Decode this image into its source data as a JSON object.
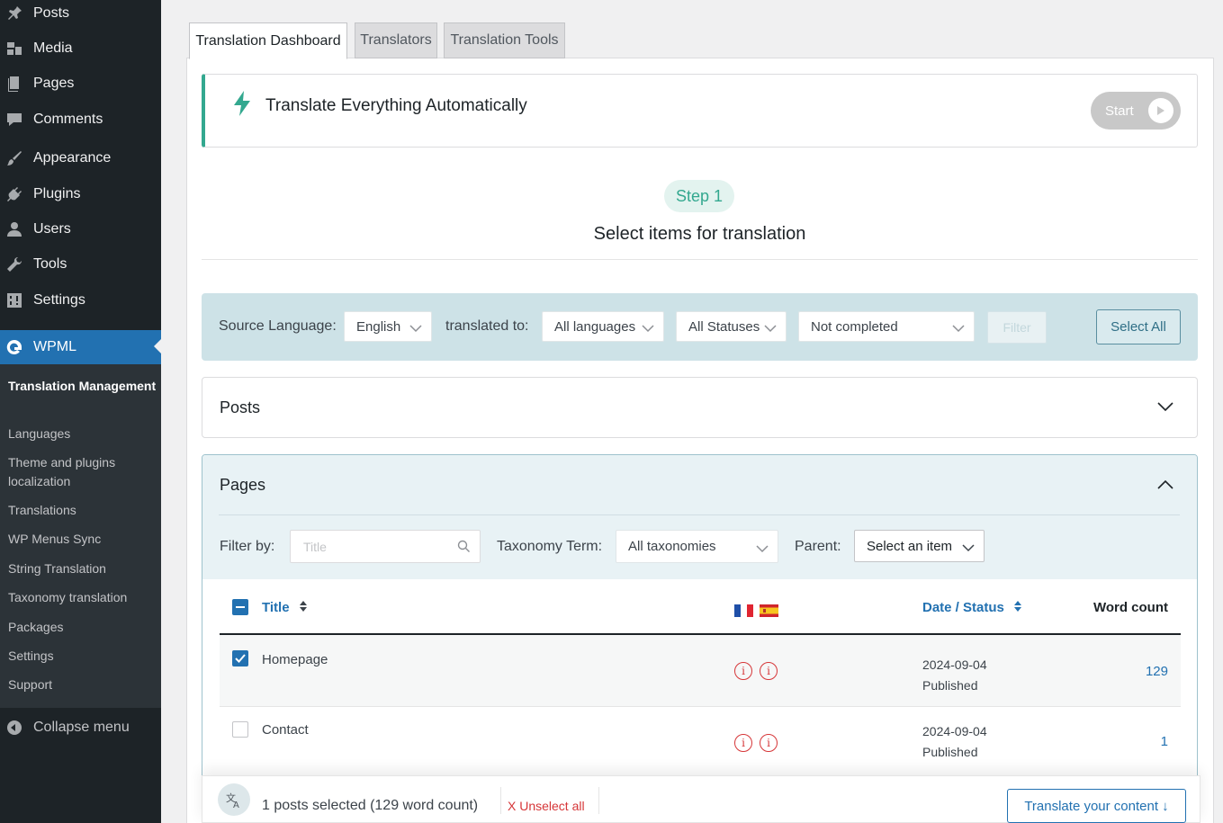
{
  "sidebar": {
    "menu": [
      {
        "label": "Posts",
        "icon": "pin-icon"
      },
      {
        "label": "Media",
        "icon": "media-icon"
      },
      {
        "label": "Pages",
        "icon": "pages-icon"
      },
      {
        "label": "Comments",
        "icon": "comment-icon"
      },
      {
        "label": "Appearance",
        "icon": "brush-icon"
      },
      {
        "label": "Plugins",
        "icon": "plug-icon"
      },
      {
        "label": "Users",
        "icon": "user-icon"
      },
      {
        "label": "Tools",
        "icon": "wrench-icon"
      },
      {
        "label": "Settings",
        "icon": "sliders-icon"
      }
    ],
    "wpml": "WPML",
    "submenu": [
      "Translation Management",
      "Languages",
      "Theme and plugins localization",
      "Translations",
      "WP Menus Sync",
      "String Translation",
      "Taxonomy translation",
      "Packages",
      "Settings",
      "Support"
    ],
    "collapse": "Collapse menu"
  },
  "tabs": [
    "Translation Dashboard",
    "Translators",
    "Translation Tools"
  ],
  "auto_translate": {
    "title": "Translate Everything Automatically",
    "start": "Start"
  },
  "step": {
    "pill": "Step 1",
    "title": "Select items for translation"
  },
  "filters": {
    "source_label": "Source Language:",
    "source_value": "English",
    "translated_label": "translated to:",
    "languages_value": "All languages",
    "statuses_value": "All Statuses",
    "completion_value": "Not completed",
    "filter_button": "Filter",
    "select_all": "Select All"
  },
  "posts_section": {
    "title": "Posts"
  },
  "pages_section": {
    "title": "Pages",
    "filter_by": "Filter by:",
    "title_placeholder": "Title",
    "taxonomy_label": "Taxonomy Term:",
    "taxonomy_value": "All taxonomies",
    "parent_label": "Parent:",
    "parent_value": "Select an item"
  },
  "table": {
    "col_title": "Title",
    "col_date": "Date / Status",
    "col_wordcount": "Word count",
    "flags": [
      "french-flag",
      "spanish-flag"
    ],
    "rows": [
      {
        "title": "Homepage",
        "date": "2024-09-04",
        "status": "Published",
        "word_count": "129",
        "checked": true
      },
      {
        "title": "Contact",
        "date": "2024-09-04",
        "status": "Published",
        "word_count": "1",
        "checked": false
      }
    ]
  },
  "bottom_bar": {
    "selected": "1 posts selected (129 word count)",
    "unselect": "X Unselect all",
    "translate": "Translate your content ↓"
  },
  "colors": {
    "sidebar_bg": "#1d2327",
    "wp_blue": "#2271b1",
    "wpml_teal": "#33a88f",
    "filter_bar": "#cde2e7",
    "error_red": "#d63638"
  }
}
